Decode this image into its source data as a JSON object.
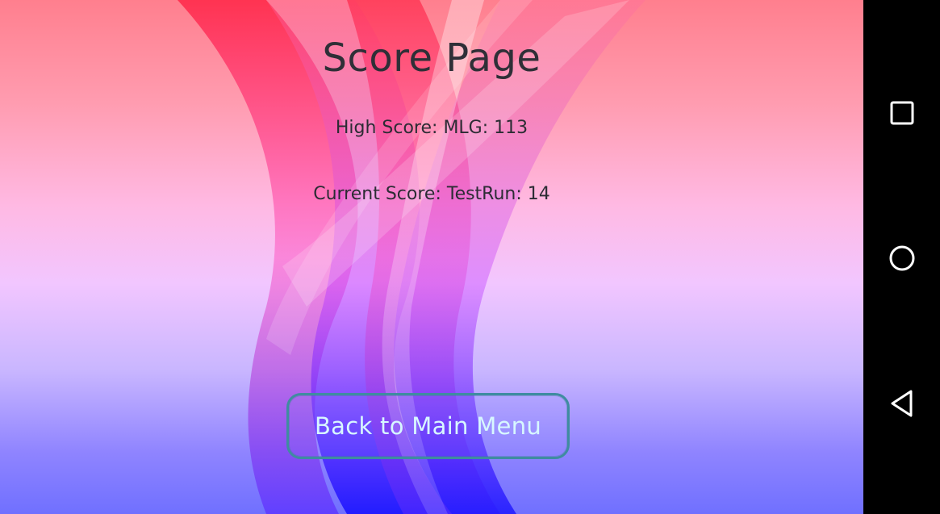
{
  "score_page": {
    "title": "Score Page",
    "high_score": "High Score: MLG: 113",
    "current_score": "Current Score: TestRun: 14",
    "back_button_label": "Back to Main Menu"
  },
  "navbar": {
    "recent_icon": "square-icon",
    "home_icon": "circle-icon",
    "back_icon": "triangle-back-icon"
  },
  "colors": {
    "button_border": "#3f8ca0",
    "button_text": "#d7f7ff",
    "title_text": "#2f2f37",
    "navbar": "#000000"
  }
}
